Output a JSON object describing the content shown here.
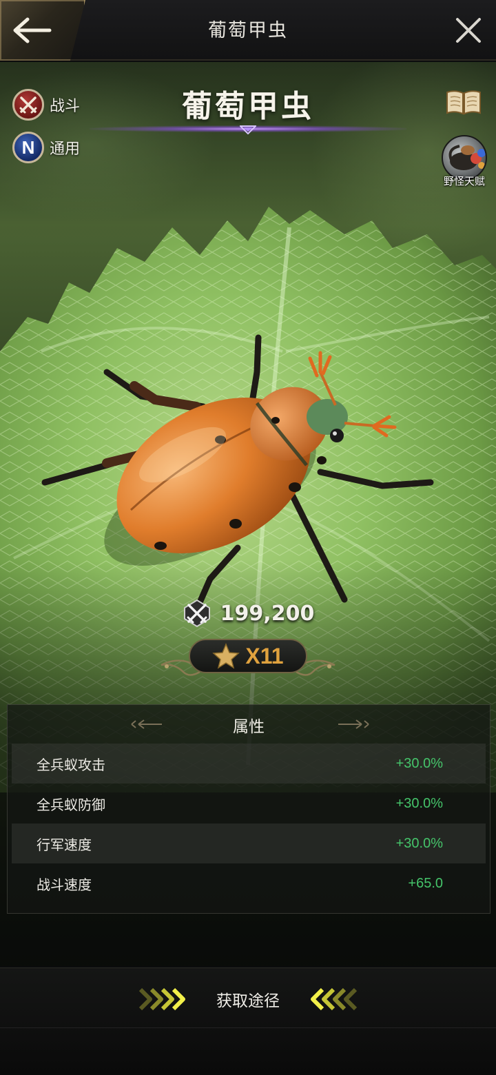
{
  "header": {
    "title": "葡萄甲虫",
    "back_icon": "arrow-left-icon",
    "close_icon": "close-icon"
  },
  "creature": {
    "name": "葡萄甲虫",
    "tags": [
      {
        "label": "战斗",
        "icon": "crossed-swords-icon"
      },
      {
        "label": "通用",
        "badge_letter": "N"
      }
    ],
    "talent_label": "野怪天赋",
    "power": "199,200",
    "stars": "X11"
  },
  "attributes": {
    "title": "属性",
    "rows": [
      {
        "name": "全兵蚁攻击",
        "value": "+30.0%"
      },
      {
        "name": "全兵蚁防御",
        "value": "+30.0%"
      },
      {
        "name": "行军速度",
        "value": "+30.0%"
      },
      {
        "name": "战斗速度",
        "value": "+65.0"
      }
    ]
  },
  "footer": {
    "obtain_label": "获取途径"
  },
  "colors": {
    "positive": "#45c46a",
    "star_gold": "#e0a23e",
    "accent_purple": "#8c50e6"
  }
}
